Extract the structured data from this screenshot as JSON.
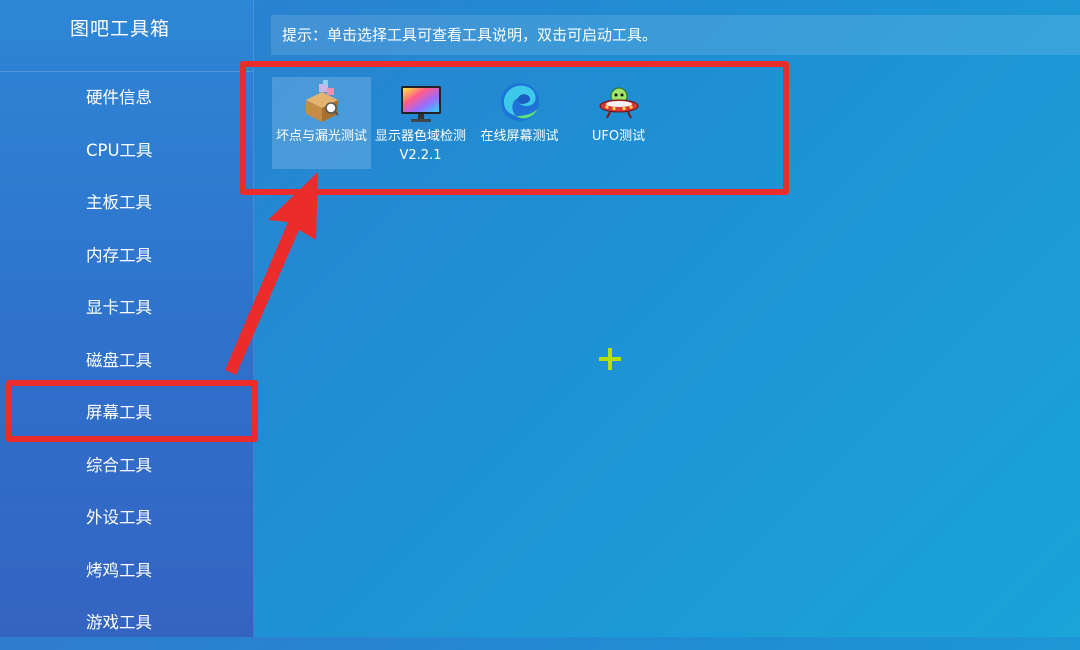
{
  "app": {
    "title": "图吧工具箱"
  },
  "sidebar": {
    "items": [
      {
        "label": "硬件信息"
      },
      {
        "label": "CPU工具"
      },
      {
        "label": "主板工具"
      },
      {
        "label": "内存工具"
      },
      {
        "label": "显卡工具"
      },
      {
        "label": "磁盘工具"
      },
      {
        "label": "屏幕工具",
        "highlighted": true
      },
      {
        "label": "综合工具"
      },
      {
        "label": "外设工具"
      },
      {
        "label": "烤鸡工具"
      },
      {
        "label": "游戏工具"
      }
    ]
  },
  "hint": {
    "text": "提示：单击选择工具可查看工具说明，双击可启动工具。"
  },
  "tools": [
    {
      "label": "坏点与漏光测试",
      "icon": "package-box-icon",
      "selected": true
    },
    {
      "label": "显示器色域检测V2.2.1",
      "icon": "monitor-color-icon",
      "selected": false
    },
    {
      "label": "在线屏幕测试",
      "icon": "edge-browser-icon",
      "selected": false
    },
    {
      "label": "UFO测试",
      "icon": "ufo-icon",
      "selected": false
    }
  ],
  "annotation": {
    "color": "#ec2b2b"
  },
  "colors": {
    "sidebar": "#2f78d0",
    "background": "#1f95d4",
    "cursor": "#b6e000"
  }
}
